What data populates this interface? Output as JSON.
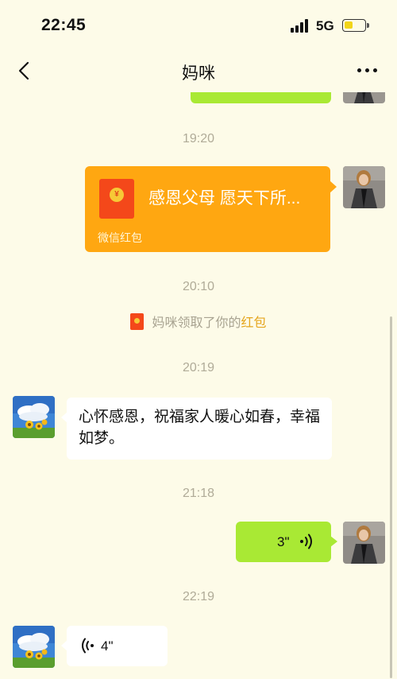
{
  "status_bar": {
    "time": "22:45",
    "network": "5G",
    "battery_level": 0.45
  },
  "nav": {
    "title": "妈咪"
  },
  "messages": {
    "ts1": "19:20",
    "red_packet": {
      "title": "感恩父母 愿天下所...",
      "label": "微信红包",
      "coin": "¥"
    },
    "ts2": "20:10",
    "system": {
      "prefix": "妈咪领取了你的",
      "highlight": "红包"
    },
    "ts3": "20:19",
    "text_message": "心怀感恩，祝福家人暖心如春，幸福如梦。",
    "ts4": "21:18",
    "voice_out_duration": "3\"",
    "ts5": "22:19",
    "voice_in_duration": "4\""
  },
  "colors": {
    "background": "#fdfbe8",
    "outgoing_bubble": "#a9e934",
    "red_packet": "#ffa711",
    "incoming_bubble": "#ffffff",
    "timestamp": "#b0ab98"
  }
}
